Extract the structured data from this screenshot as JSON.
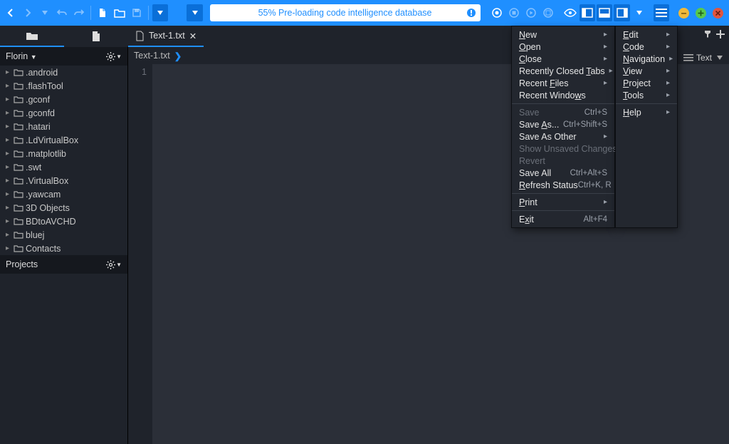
{
  "toolbar": {
    "loading_text": "55% Pre-loading code intelligence database"
  },
  "tabs": {
    "file_tab": "Text-1.txt"
  },
  "sidebar": {
    "panel1_title": "Florin",
    "panel2_title": "Projects",
    "nodes": [
      ".android",
      ".flashTool",
      ".gconf",
      ".gconfd",
      ".hatari",
      ".LdVirtualBox",
      ".matplotlib",
      ".swt",
      ".VirtualBox",
      ".yawcam",
      "3D Objects",
      "BDtoAVCHD",
      "bluej",
      "Contacts"
    ]
  },
  "breadcrumb": {
    "item": "Text-1.txt"
  },
  "editor": {
    "line": "1"
  },
  "rightrail": {
    "text_label": "Text"
  },
  "menu_col1": [
    {
      "label": "New",
      "u": "N",
      "sub": true
    },
    {
      "label": "Open",
      "u": "O",
      "sub": true
    },
    {
      "label": "Close",
      "u": "C",
      "sub": true
    },
    {
      "label": "Recently Closed Tabs",
      "u": "T",
      "sub": true
    },
    {
      "label": "Recent Files",
      "u": "F",
      "sub": true
    },
    {
      "label": "Recent Windows",
      "u": "w",
      "sub": false
    },
    {
      "sep": true
    },
    {
      "label": "Save",
      "sc": "Ctrl+S",
      "dis": true
    },
    {
      "label": "Save As...",
      "u": "A",
      "sc": "Ctrl+Shift+S"
    },
    {
      "label": "Save As Other",
      "sub": true
    },
    {
      "label": "Show Unsaved Changes",
      "dis": true
    },
    {
      "label": "Revert",
      "dis": true
    },
    {
      "label": "Save All",
      "sc": "Ctrl+Alt+S"
    },
    {
      "label": "Refresh Status",
      "u": "R",
      "sc": "Ctrl+K, R"
    },
    {
      "sep": true
    },
    {
      "label": "Print",
      "u": "P",
      "sub": true
    },
    {
      "sep": true
    },
    {
      "label": "Exit",
      "u": "x",
      "sc": "Alt+F4"
    }
  ],
  "menu_col2": [
    {
      "label": "Edit",
      "u": "E",
      "sub": true
    },
    {
      "label": "Code",
      "u": "C",
      "sub": true
    },
    {
      "label": "Navigation",
      "u": "N",
      "sub": true
    },
    {
      "label": "View",
      "u": "V",
      "sub": true
    },
    {
      "label": "Project",
      "u": "P",
      "sub": true
    },
    {
      "label": "Tools",
      "u": "T",
      "sub": true
    },
    {
      "sep": true
    },
    {
      "label": "Help",
      "u": "H",
      "sub": true
    }
  ]
}
